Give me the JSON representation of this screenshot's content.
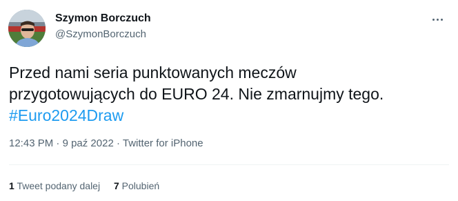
{
  "author": {
    "display_name": "Szymon Borczuch",
    "handle": "@SzymonBorczuch"
  },
  "tweet": {
    "line1": "Przed nami seria punktowanych meczów",
    "line2": "przygotowujących do EURO 24. Nie zmarnujmy tego.",
    "hashtag": "#Euro2024Draw"
  },
  "meta": {
    "time": "12:43 PM",
    "date": "9 paź 2022",
    "source": "Twitter for iPhone",
    "separator": "·"
  },
  "stats": {
    "retweets_count": "1",
    "retweets_label": "Tweet podany dalej",
    "likes_count": "7",
    "likes_label": "Polubień"
  },
  "colors": {
    "link": "#1d9bf0",
    "secondary_text": "#536471",
    "primary_text": "#0f1419"
  }
}
